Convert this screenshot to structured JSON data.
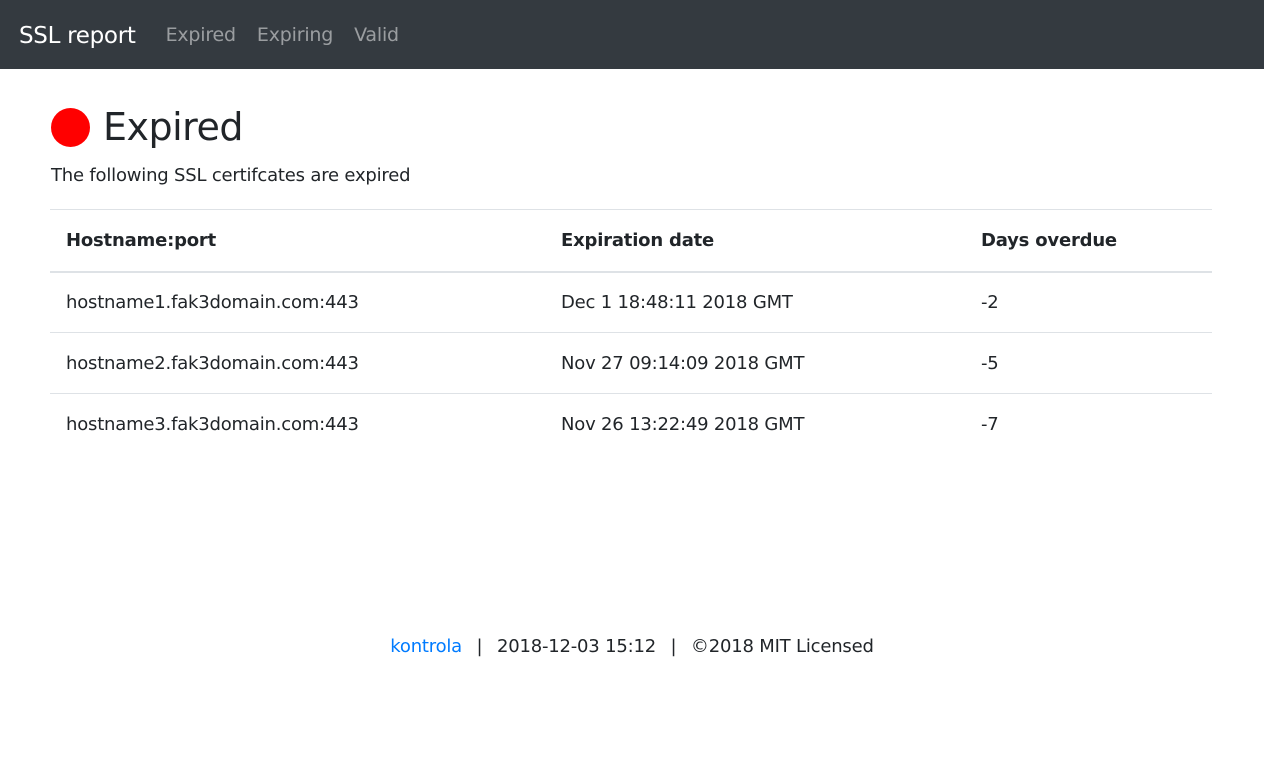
{
  "nav": {
    "brand": "SSL report",
    "links": [
      "Expired",
      "Expiring",
      "Valid"
    ]
  },
  "page": {
    "title": "Expired",
    "status_color": "#ff0000",
    "description": "The following SSL certifcates are expired"
  },
  "table": {
    "headers": [
      "Hostname:port",
      "Expiration date",
      "Days overdue"
    ],
    "rows": [
      [
        "hostname1.fak3domain.com:443",
        "Dec 1 18:48:11 2018 GMT",
        "-2"
      ],
      [
        "hostname2.fak3domain.com:443",
        "Nov 27 09:14:09 2018 GMT",
        "-5"
      ],
      [
        "hostname3.fak3domain.com:443",
        "Nov 26 13:22:49 2018 GMT",
        "-7"
      ]
    ]
  },
  "footer": {
    "link": "kontrola",
    "separator": "|",
    "timestamp": "2018-12-03 15:12",
    "license": "©2018 MIT Licensed"
  }
}
